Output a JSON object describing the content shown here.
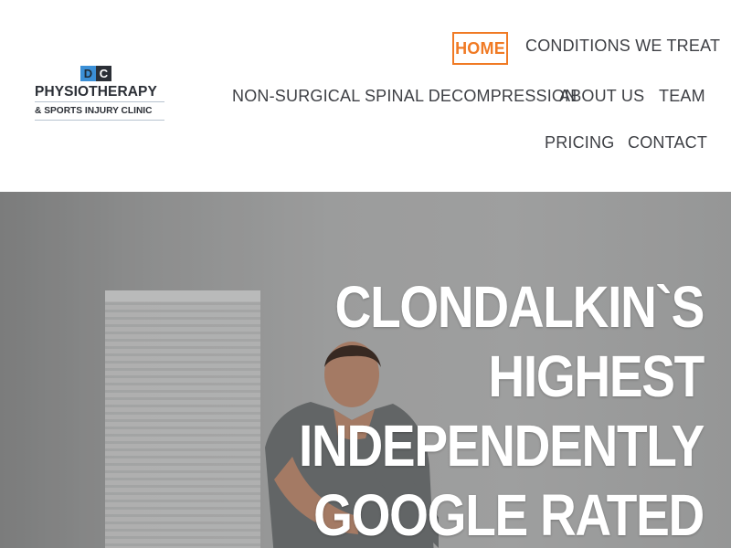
{
  "logo": {
    "badge_left": "D",
    "badge_right": "C",
    "line1": "PHYSIOTHERAPY",
    "line2": "& SPORTS INJURY CLINIC",
    "accent_color": "#3b8fd6",
    "dark_color": "#2b2f36"
  },
  "nav": {
    "items": [
      {
        "label": "HOME",
        "active": true
      },
      {
        "label": "CONDITIONS WE TREAT"
      },
      {
        "label": "NON-SURGICAL SPINAL DECOMPRESSION"
      },
      {
        "label": "ABOUT US"
      },
      {
        "label": "TEAM"
      },
      {
        "label": "PRICING"
      },
      {
        "label": "CONTACT"
      }
    ],
    "active_color": "#f07a24",
    "text_color": "#3d3f44"
  },
  "hero": {
    "heading_lines": [
      "CLONDALKIN`S",
      "HIGHEST",
      "INDEPENDENTLY",
      "GOOGLE RATED"
    ],
    "heading_color": "#ffffff",
    "image": "physiotherapist-treating-patient-photo"
  }
}
